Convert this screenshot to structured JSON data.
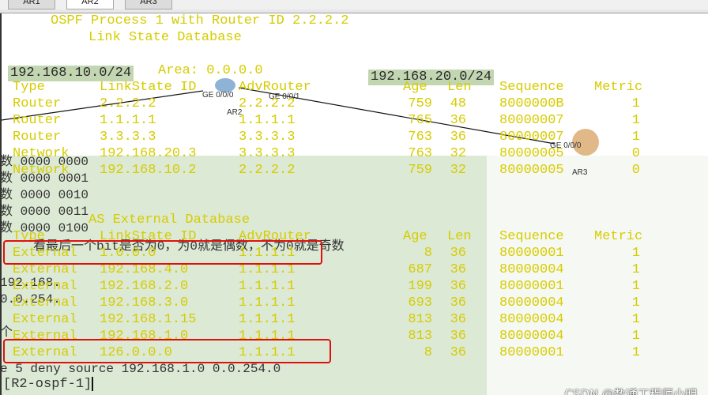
{
  "tabs": [
    {
      "label": "AR1",
      "active": false
    },
    {
      "label": "AR2",
      "active": true
    },
    {
      "label": "AR3",
      "active": false
    }
  ],
  "header": {
    "process_line": "OSPF Process 1 with Router ID 2.2.2.2",
    "db_title": "Link State Database",
    "area_line": "Area: 0.0.0.0"
  },
  "background": {
    "net_left": "192.168.10.0/24",
    "net_right": "192.168.20.0/24",
    "ge1": "GE 0/0/0",
    "ge2": "GE 0/0/1",
    "ge3": "GE 0/0/0",
    "ar2": "AR2",
    "ar3": "AR3",
    "ghost_lines": [
      "数 0000 0000",
      "数 0000 0001",
      "数 0000 0010",
      "数 0000 0011",
      "数 0000 0100",
      "看最后一个bit是否为0，为0就是偶数，不为0就是奇数",
      "192.168.",
      "0.0.254.",
      "个",
      "e 5 deny source 192.168.1.0 0.0.254.0"
    ]
  },
  "lsdb": {
    "columns": [
      "Type",
      "LinkState ID",
      "AdvRouter",
      "Age",
      "Len",
      "Sequence",
      "Metric"
    ],
    "rows": [
      [
        "Router",
        "2.2.2.2",
        "2.2.2.2",
        "759",
        "48",
        "8000000B",
        "1"
      ],
      [
        "Router",
        "1.1.1.1",
        "1.1.1.1",
        "765",
        "36",
        "80000007",
        "1"
      ],
      [
        "Router",
        "3.3.3.3",
        "3.3.3.3",
        "763",
        "36",
        "80000007",
        "1"
      ],
      [
        "Network",
        "192.168.20.3",
        "3.3.3.3",
        "763",
        "32",
        "80000005",
        "0"
      ],
      [
        "Network",
        "192.168.10.2",
        "2.2.2.2",
        "759",
        "32",
        "80000005",
        "0"
      ]
    ]
  },
  "external": {
    "title": "AS External Database",
    "columns": [
      "Type",
      "LinkState ID",
      "AdvRouter",
      "Age",
      "Len",
      "Sequence",
      "Metric"
    ],
    "rows": [
      [
        "External",
        "1.0.0.0",
        "1.1.1.1",
        "8",
        "36",
        "80000001",
        "1"
      ],
      [
        "External",
        "192.168.4.0",
        "1.1.1.1",
        "687",
        "36",
        "80000004",
        "1"
      ],
      [
        "External",
        "192.168.2.0",
        "1.1.1.1",
        "199",
        "36",
        "80000001",
        "1"
      ],
      [
        "External",
        "192.168.3.0",
        "1.1.1.1",
        "693",
        "36",
        "80000004",
        "1"
      ],
      [
        "External",
        "192.168.1.15",
        "1.1.1.1",
        "813",
        "36",
        "80000004",
        "1"
      ],
      [
        "External",
        "192.168.1.0",
        "1.1.1.1",
        "813",
        "36",
        "80000004",
        "1"
      ],
      [
        "External",
        "126.0.0.0",
        "1.1.1.1",
        "8",
        "36",
        "80000001",
        "1"
      ]
    ]
  },
  "prompt": "[R2-ospf-1]",
  "watermark": "CSDN @数通工程师小明",
  "colors": {
    "terminal_text": "#d6cc00",
    "highlight_box": "#e01010",
    "overlay_green": "#dce9d5"
  }
}
